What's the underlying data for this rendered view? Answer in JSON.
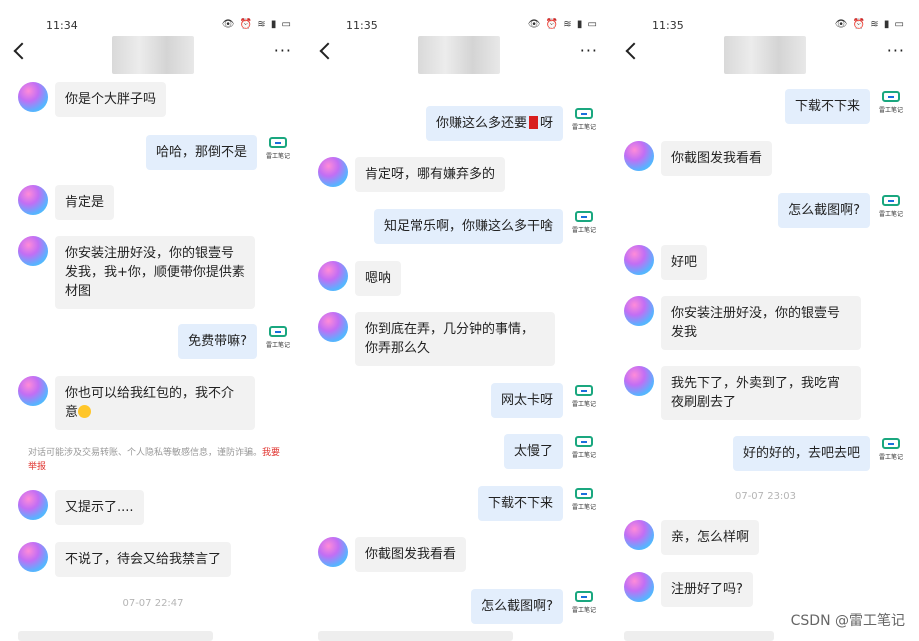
{
  "panels": [
    {
      "time": "11:34",
      "messages": [
        {
          "dir": "in",
          "text": "你是个大胖子吗"
        },
        {
          "dir": "out",
          "text": "哈哈，那倒不是"
        },
        {
          "dir": "in",
          "text": "肯定是"
        },
        {
          "dir": "in",
          "text": "你安装注册好没，你的银壹号发我，我+你，顺便带你提供素材图"
        },
        {
          "dir": "out",
          "text": "免费带嘛?"
        },
        {
          "dir": "in",
          "text": "你也可以给我红包的，我不介意"
        },
        {
          "dir": "in",
          "text": "又提示了...."
        },
        {
          "dir": "in",
          "text": "不说了，待会又给我禁言了"
        }
      ],
      "notice": "对话可能涉及交易转账、个人隐私等敏感信息，谨防诈骗。",
      "notice_report": "我要举报",
      "timestamp": "07-07 22:47"
    },
    {
      "time": "11:35",
      "messages": [
        {
          "dir": "out",
          "text": "你赚这么多还要",
          "text2": "呀"
        },
        {
          "dir": "in",
          "text": "肯定呀，哪有嫌弃多的"
        },
        {
          "dir": "out",
          "text": "知足常乐啊，你赚这么多干啥"
        },
        {
          "dir": "in",
          "text": "嗯呐"
        },
        {
          "dir": "in",
          "text": "你到底在弄，几分钟的事情，你弄那么久"
        },
        {
          "dir": "out",
          "text": "网太卡呀"
        },
        {
          "dir": "out",
          "text": "太慢了"
        },
        {
          "dir": "out",
          "text": "下载不下来"
        },
        {
          "dir": "in",
          "text": "你截图发我看看"
        },
        {
          "dir": "out",
          "text": "怎么截图啊?"
        }
      ]
    },
    {
      "time": "11:35",
      "messages": [
        {
          "dir": "out",
          "text": "下载不下来"
        },
        {
          "dir": "in",
          "text": "你截图发我看看"
        },
        {
          "dir": "out",
          "text": "怎么截图啊?"
        },
        {
          "dir": "in",
          "text": "好吧"
        },
        {
          "dir": "in",
          "text": "你安装注册好没，你的银壹号发我"
        },
        {
          "dir": "in",
          "text": "我先下了，外卖到了，我吃宵夜刷剧去了"
        },
        {
          "dir": "out",
          "text": "好的好的，去吧去吧"
        },
        {
          "dir": "in",
          "text": "亲，怎么样啊"
        },
        {
          "dir": "in",
          "text": "注册好了吗?"
        }
      ],
      "timestamp": "07-07 23:03"
    }
  ],
  "bot_caption": "雷工笔记",
  "watermark": "CSDN @雷工笔记",
  "icons": {
    "status_icons": [
      "eye-icon",
      "alarm-icon",
      "wifi-icon",
      "signal-icon",
      "battery-icon"
    ],
    "back": "back-arrow-icon",
    "more": "more-dots-icon",
    "avatar": "gradient-avatar",
    "bot": "leigong-bot-logo"
  },
  "colors": {
    "incoming_bubble": "#f2f2f2",
    "outgoing_bubble": "#e3eefc",
    "report_link": "#e0342f"
  }
}
